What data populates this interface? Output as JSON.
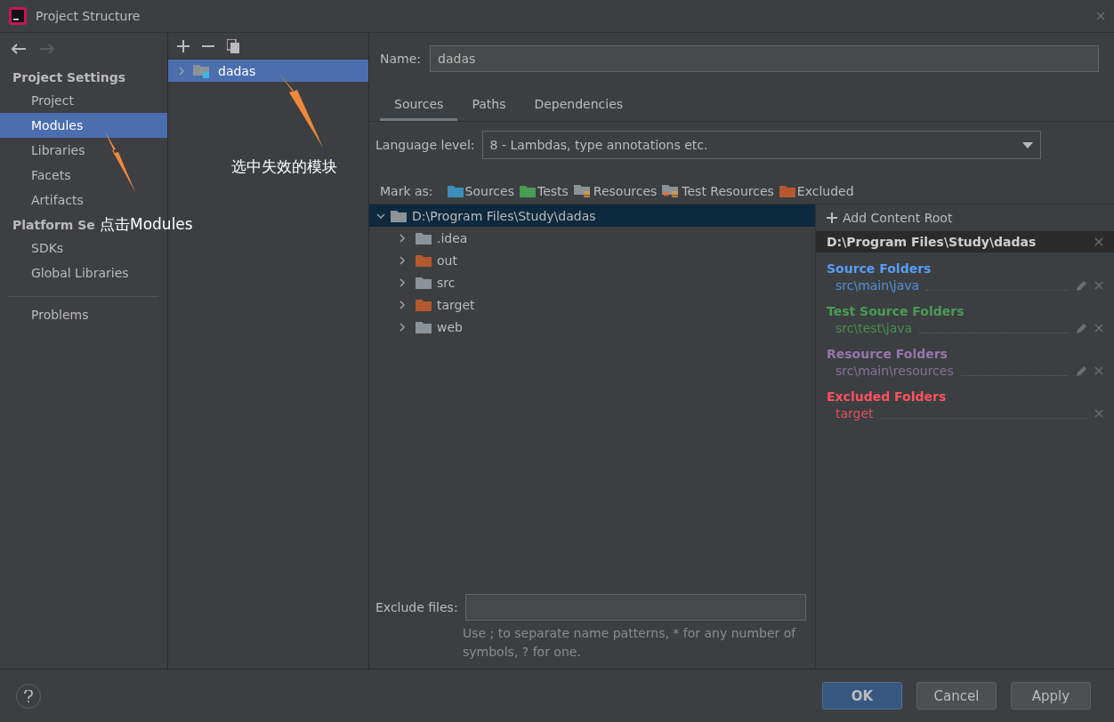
{
  "window": {
    "title": "Project Structure"
  },
  "sidebar": {
    "groups": [
      {
        "title": "Project Settings",
        "items": [
          {
            "label": "Project",
            "selected": false
          },
          {
            "label": "Modules",
            "selected": true
          },
          {
            "label": "Libraries",
            "selected": false
          },
          {
            "label": "Facets",
            "selected": false
          },
          {
            "label": "Artifacts",
            "selected": false
          }
        ]
      },
      {
        "title": "Platform Se",
        "items": [
          {
            "label": "SDKs",
            "selected": false
          },
          {
            "label": "Global Libraries",
            "selected": false
          }
        ]
      },
      {
        "items": [
          {
            "label": "Problems",
            "selected": false
          }
        ]
      }
    ]
  },
  "modules": [
    {
      "label": "dadas",
      "selected": true
    }
  ],
  "name": {
    "label": "Name:",
    "value": "dadas"
  },
  "tabs": [
    {
      "label": "Sources",
      "selected": true
    },
    {
      "label": "Paths",
      "selected": false
    },
    {
      "label": "Dependencies",
      "selected": false
    }
  ],
  "language_level": {
    "label": "Language level:",
    "value": "8 - Lambdas, type annotations etc."
  },
  "mark_as": {
    "label": "Mark as:",
    "items": [
      {
        "label": "Sources",
        "kind": "sources"
      },
      {
        "label": "Tests",
        "kind": "tests"
      },
      {
        "label": "Resources",
        "kind": "resources"
      },
      {
        "label": "Test Resources",
        "kind": "test-resources"
      },
      {
        "label": "Excluded",
        "kind": "excluded"
      }
    ]
  },
  "tree": {
    "label": "D:\\Program Files\\Study\\dadas",
    "expanded": true,
    "selected": true,
    "children": [
      {
        "label": ".idea",
        "kind": "plain",
        "expanded": false
      },
      {
        "label": "out",
        "kind": "excluded",
        "expanded": false
      },
      {
        "label": "src",
        "kind": "plain",
        "expanded": false
      },
      {
        "label": "target",
        "kind": "excluded",
        "expanded": false
      },
      {
        "label": "web",
        "kind": "plain",
        "expanded": false
      }
    ]
  },
  "content_root": {
    "add": "Add Content Root",
    "path": "D:\\Program Files\\Study\\dadas",
    "groups": [
      {
        "title": "Source Folders",
        "color": "#589df6",
        "folders": [
          {
            "path": "src\\main\\java",
            "editable": true
          }
        ]
      },
      {
        "title": "Test Source Folders",
        "color": "#499c54",
        "folders": [
          {
            "path": "src\\test\\java",
            "editable": true
          }
        ]
      },
      {
        "title": "Resource Folders",
        "color": "#9876aa",
        "folders": [
          {
            "path": "src\\main\\resources",
            "editable": true
          }
        ]
      },
      {
        "title": "Excluded Folders",
        "color": "#ff5261",
        "folders": [
          {
            "path": "target",
            "editable": false
          }
        ]
      }
    ]
  },
  "exclude_files": {
    "label": "Exclude files:",
    "hint": "Use ; to separate name patterns, * for any number of symbols, ? for one."
  },
  "buttons": [
    {
      "label": "OK",
      "kind": "default"
    },
    {
      "label": "Cancel",
      "kind": "plain"
    },
    {
      "label": "Apply",
      "kind": "plain"
    }
  ],
  "annotations": [
    {
      "text": "点击Modules"
    },
    {
      "text": "选中失效的模块"
    }
  ]
}
